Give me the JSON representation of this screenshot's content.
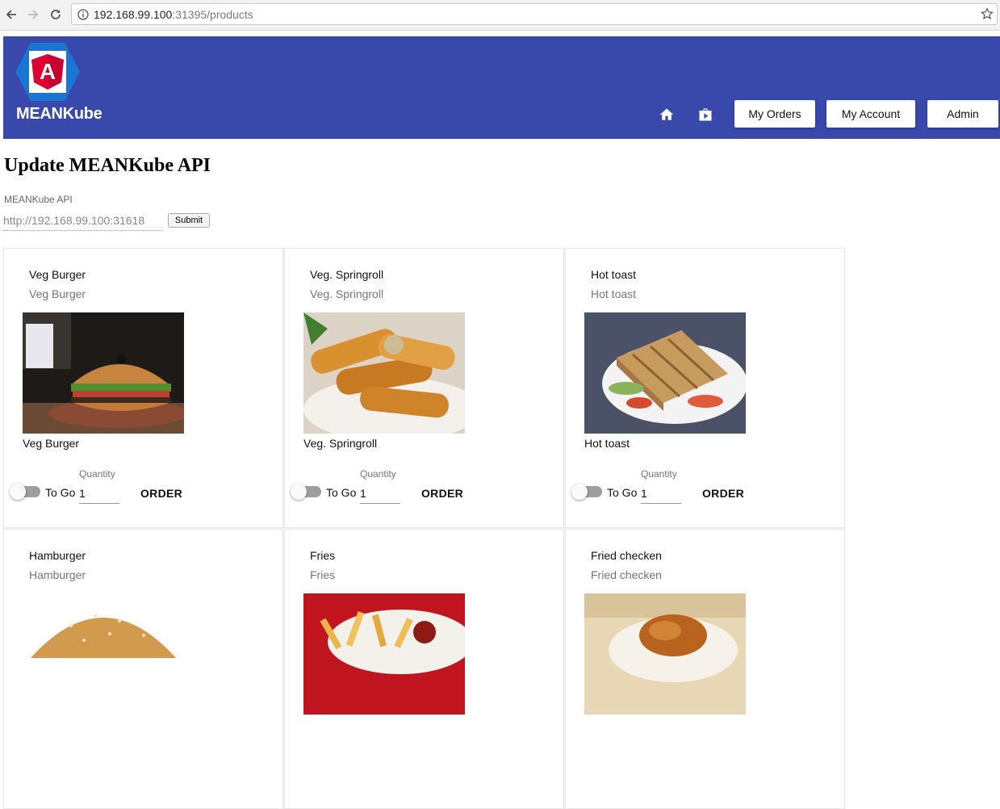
{
  "browser": {
    "url_host": "192.168.99.100",
    "url_rest": ":31395/products",
    "back_icon": "back-arrow-icon",
    "forward_icon": "forward-arrow-icon",
    "reload_icon": "reload-icon",
    "info_icon": "info-icon",
    "bookmark_icon": "star-icon"
  },
  "header": {
    "brand": "MEANKube",
    "logo_letter": "A",
    "nav_icons": [
      "home-icon",
      "store-icon"
    ],
    "buttons": {
      "orders": "My Orders",
      "account": "My Account",
      "admin": "Admin"
    },
    "colors": {
      "bar": "#3949ab",
      "logo_hex": "#1976d2",
      "logo_shield": "#dd0031"
    }
  },
  "api_section": {
    "title": "Update MEANKube API",
    "label": "MEANKube API",
    "value": "http://192.168.99.100:31618",
    "submit": "Submit"
  },
  "product_common": {
    "quantity_label": "Quantity",
    "to_go_label": "To Go",
    "order_label": "ORDER"
  },
  "products": [
    {
      "title": "Veg Burger",
      "subtitle": "Veg Burger",
      "caption": "Veg Burger",
      "quantity": "1",
      "to_go": false
    },
    {
      "title": "Veg. Springroll",
      "subtitle": "Veg. Springroll",
      "caption": "Veg. Springroll",
      "quantity": "1",
      "to_go": false
    },
    {
      "title": "Hot toast",
      "subtitle": "Hot toast",
      "caption": "Hot toast",
      "quantity": "1",
      "to_go": false
    },
    {
      "title": "Hamburger",
      "subtitle": "Hamburger"
    },
    {
      "title": "Fries",
      "subtitle": "Fries"
    },
    {
      "title": "Fried checken",
      "subtitle": "Fried checken"
    }
  ]
}
